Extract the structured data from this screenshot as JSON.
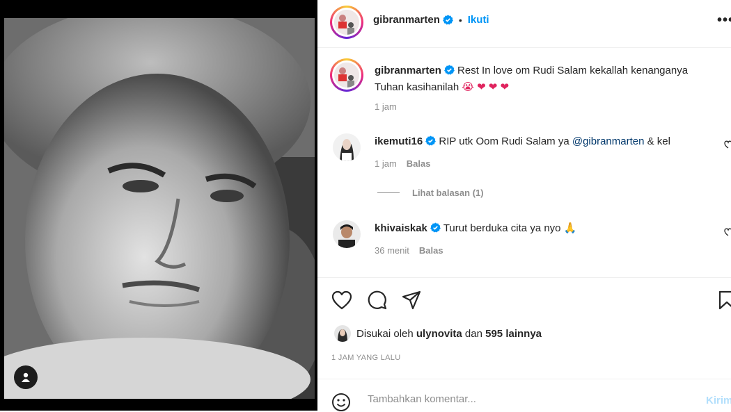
{
  "post": {
    "author": "gibranmarten",
    "follow_label": "Ikuti",
    "more_label": "•••",
    "caption_text": "Rest In love om Rudi Salam kekallah kenanganya Tuhan kasihanilah",
    "caption_emojis": "😭 ❤ ❤ ❤",
    "caption_time": "1 jam"
  },
  "comments": [
    {
      "username": "ikemuti16",
      "text_before": "RIP utk Oom Rudi Salam ya ",
      "mention": "@gibranmarten",
      "text_after": " & kel",
      "time": "1 jam",
      "reply_label": "Balas",
      "view_replies": "Lihat balasan (1)"
    },
    {
      "username": "khivaiskak",
      "text": "Turut berduka cita ya nyo 🙏",
      "time": "36 menit",
      "reply_label": "Balas"
    }
  ],
  "likes": {
    "prefix": "Disukai oleh",
    "user": "ulynovita",
    "middle": "dan",
    "others": "595 lainnya"
  },
  "timestamp": "1 JAM YANG LALU",
  "comment_box": {
    "placeholder": "Tambahkan komentar...",
    "post_label": "Kirim"
  },
  "colors": {
    "accent": "#0095f6",
    "verified": "#0095f6",
    "mention": "#00376b",
    "muted": "#8e8e8e"
  },
  "icons": [
    "heart-icon",
    "comment-icon",
    "share-icon",
    "bookmark-icon",
    "emoji-icon",
    "verified-badge-icon",
    "user-tag-icon"
  ]
}
